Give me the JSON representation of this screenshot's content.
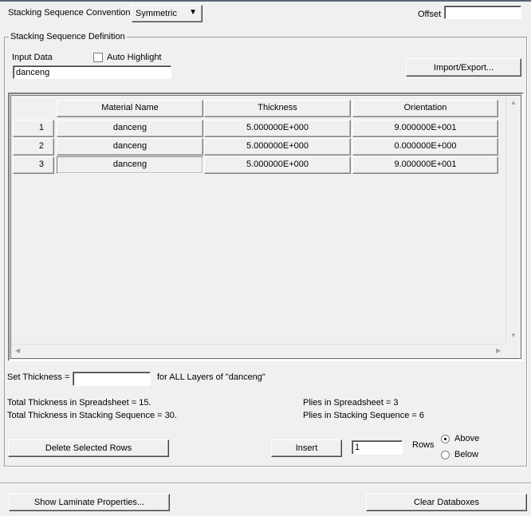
{
  "header": {
    "convention_label": "Stacking Sequence Convention",
    "convention_value": "Symmetric",
    "offset_label": "Offset",
    "offset_value": ""
  },
  "group": {
    "title": "Stacking Sequence Definition",
    "input_data_label": "Input Data",
    "auto_highlight_label": "Auto Highlight",
    "auto_highlight_checked": false,
    "input_data_value": "danceng",
    "import_export_label": "Import/Export..."
  },
  "table": {
    "columns": [
      "Material Name",
      "Thickness",
      "Orientation"
    ],
    "rows": [
      {
        "index": "1",
        "material": "danceng",
        "thickness": "5.000000E+000",
        "orientation": "9.000000E+001"
      },
      {
        "index": "2",
        "material": "danceng",
        "thickness": "5.000000E+000",
        "orientation": "0.000000E+000"
      },
      {
        "index": "3",
        "material": "danceng",
        "thickness": "5.000000E+000",
        "orientation": "9.000000E+001"
      }
    ]
  },
  "thickness": {
    "label": "Set Thickness =",
    "value": "",
    "suffix": "for ALL Layers of  \"danceng\""
  },
  "totals": {
    "spreadsheet": "Total Thickness in Spreadsheet = 15.",
    "stacking": "Total Thickness in Stacking Sequence = 30.",
    "plies_spreadsheet": "Plies in Spreadsheet = 3",
    "plies_stacking": "Plies in Stacking Sequence = 6"
  },
  "rows_ctrl": {
    "delete_label": "Delete Selected Rows",
    "insert_label": "Insert",
    "count": "1",
    "rows_label": "Rows",
    "above_label": "Above",
    "below_label": "Below",
    "selected": "Above"
  },
  "footer": {
    "show_props_label": "Show Laminate Properties...",
    "clear_label": "Clear Databoxes"
  }
}
